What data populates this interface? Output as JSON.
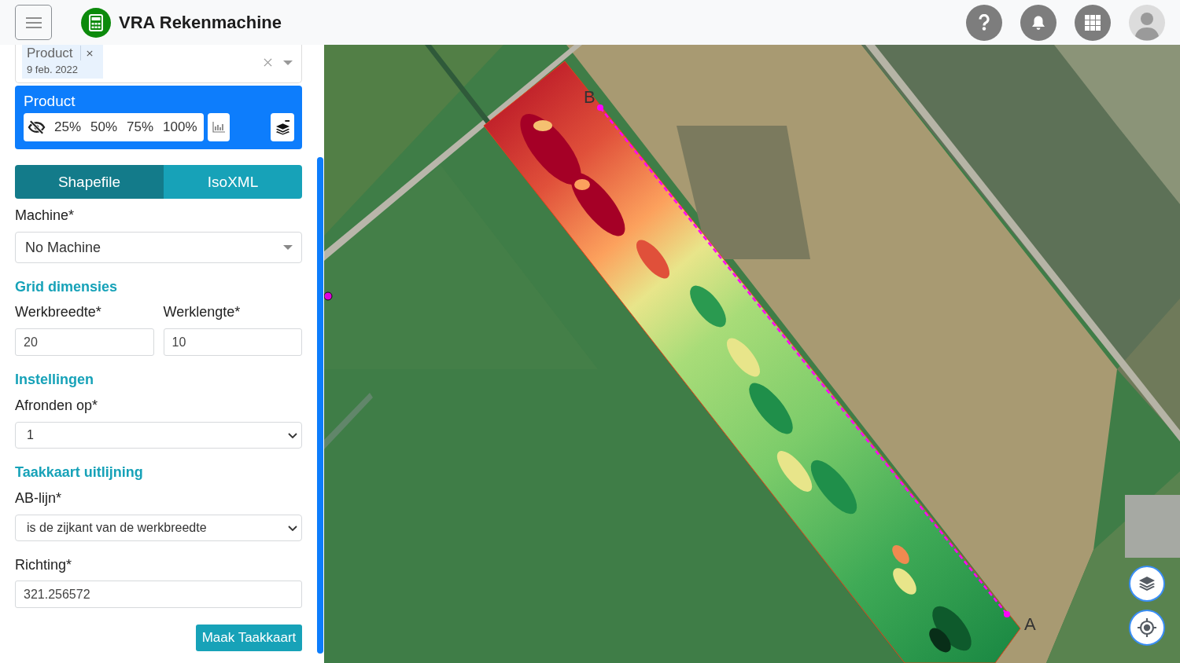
{
  "header": {
    "title": "VRA Rekenmachine"
  },
  "product_select": {
    "tags": [
      {
        "name": "Product",
        "date": "9 feb. 2022"
      }
    ]
  },
  "layer_card": {
    "title": "Product",
    "opacity_options": [
      {
        "label": "25%",
        "selected": false
      },
      {
        "label": "50%",
        "selected": false
      },
      {
        "label": "75%",
        "selected": false
      },
      {
        "label": "100%",
        "selected": false
      }
    ]
  },
  "export_tabs": [
    {
      "label": "Shapefile",
      "selected": true
    },
    {
      "label": "IsoXML",
      "selected": false
    }
  ],
  "machine": {
    "label": "Machine*",
    "value": "No Machine"
  },
  "grid": {
    "heading": "Grid dimensies",
    "fields": [
      {
        "label": "Werkbreedte*",
        "value": "20"
      },
      {
        "label": "Werklengte*",
        "value": "10"
      }
    ]
  },
  "settings": {
    "heading": "Instellingen",
    "rounding": {
      "label": "Afronden op*",
      "value": "1"
    }
  },
  "alignment": {
    "heading": "Taakkaart uitlijning",
    "ab_line": {
      "label": "AB-lijn*",
      "value": "is de zijkant van de werkbreedte"
    },
    "direction": {
      "label": "Richting*",
      "value": "321.256572"
    }
  },
  "submit_button": "Maak Taakkaart",
  "map": {
    "ab_line": {
      "point_b_label": "B",
      "point_a_label": "A"
    }
  }
}
